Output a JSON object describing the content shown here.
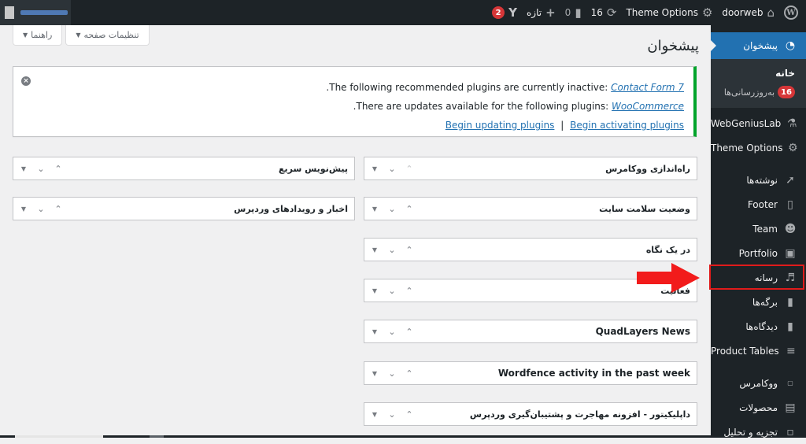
{
  "adminbar": {
    "wp_logo": "W",
    "site_name": "doorweb",
    "theme_options": "Theme Options",
    "updates_count": "16",
    "comments_count": "0",
    "new_label": "تازه",
    "yoast_badge": "2",
    "icons": {
      "wp": "wordpress-icon",
      "home": "home-icon",
      "gear": "gear-icon",
      "updates": "refresh-icon",
      "comments": "comment-icon",
      "plus": "plus-icon",
      "yoast": "yoast-icon"
    }
  },
  "sidebar": {
    "items": [
      {
        "label": "پیشخوان",
        "icon": "dashboard-icon",
        "current": true
      },
      {
        "label": "WebGeniusLab",
        "icon": "flask-icon"
      },
      {
        "label": "Theme Options",
        "icon": "gear-icon"
      },
      {
        "label": "نوشته‌ها",
        "icon": "pin-icon"
      },
      {
        "label": "Footer",
        "icon": "page-icon"
      },
      {
        "label": "Team",
        "icon": "groups-icon"
      },
      {
        "label": "Portfolio",
        "icon": "portfolio-icon"
      },
      {
        "label": "رسانه",
        "icon": "media-icon",
        "highlighted": true
      },
      {
        "label": "برگه‌ها",
        "icon": "pages-icon"
      },
      {
        "label": "دیدگاه‌ها",
        "icon": "comment-icon"
      },
      {
        "label": "Product Tables",
        "icon": "list-icon"
      },
      {
        "label": "ووکامرس",
        "icon": "woo-icon"
      },
      {
        "label": "محصولات",
        "icon": "archive-icon"
      },
      {
        "label": "تجزیه و تحلیل",
        "icon": "chart-icon"
      }
    ],
    "submenu": [
      {
        "label": "خانه",
        "current": true
      },
      {
        "label": "به‌روزرسانی‌ها",
        "badge": "16"
      }
    ]
  },
  "screen_meta": {
    "screen_options": "تنظیمات صفحه",
    "help": "راهنما"
  },
  "page": {
    "title": "پیشخوان"
  },
  "notice": {
    "line1_text": "The following recommended plugins are currently inactive:",
    "line1_link": "Contact Form 7",
    "line2_text": "There are updates available for the following plugins:",
    "line2_link": "WooCommerce",
    "link_update": "Begin updating plugins",
    "separator": "|",
    "link_activate": "Begin activating plugins",
    "period": "."
  },
  "widgets": {
    "right": [
      "راه‌اندازی ووکامرس",
      "وضعیت سلامت سایت",
      "در یک نگاه",
      "فعالیت",
      "QuadLayers News",
      "Wordfence activity in the past week",
      "داپلیکیتور - افزونه مهاجرت و پشتیبان‌گیری وردپرس"
    ],
    "left": [
      "پیش‌نویس سریع",
      "اخبار و رویدادهای وردپرس"
    ]
  }
}
